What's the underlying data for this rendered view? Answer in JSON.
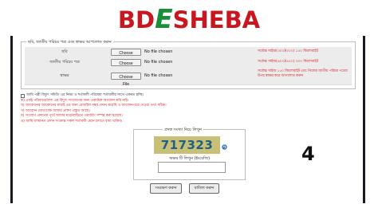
{
  "logo": {
    "part1": "BD",
    "part2": "E",
    "part3": "SHEBA"
  },
  "upload": {
    "legend": "ছবি, জাতীয় পরিচয় পত্র এবং স্বাক্ষর আপলোড করুন",
    "rows": [
      {
        "label": "ছবি",
        "button": "Choose File",
        "status": "No file chosen",
        "note": "সর্বোচ্চ সাইজ(৩০০X৩০০) ১৫০ কিলোবাইট"
      },
      {
        "label": "জাতীয় পরিচয় পত্র",
        "button": "Choose File",
        "status": "No file chosen",
        "note": "সর্বোচ্চ সাইজ(৬০০X৪৫০) ৩০০ কিলোবাইট"
      },
      {
        "label": "স্বাক্ষর",
        "button": "Choose File",
        "status": "No file chosen",
        "note": "সর্বোচ্চ সাইজ ১৫০ কিলোবাইট এবং নিজের জাতীয় পরিচয় পত্রের উপর স্বাক্ষর করে আপলোড করুন"
      }
    ]
  },
  "terms": {
    "agree": "আমি পল্লী বিদ্যুৎ সমিতি এর নিয়ম ও শর্তাবলী পরিষেবা শর্তাবলীর সাথে একমত হচ্ছি।",
    "items": [
      "ক) একই পরিবারে/বাসা এর বিদ্যুৎ সংযোগের জন্য একাধিক আবেদন করি নাই।",
      "খ) আবেদনের আবেদনের যাচাই এর জন্য মোবাইল নম্বর প্রদান করেছি ও আবেদনপত্রে দেওয়া তথ্য সঠিক।",
      "গ) আবেদন মোতাবেক আমার প্রাঙ্গণ প্রস্তুত আছে।",
      "ঘ) সংযোগ প্রদানের পূর্বে আমার ঘরে/বাড়িতে ওয়্যারিং সম্পন্ন করা হয়েছে।",
      "ঙ) আমি জামানত প্রদান সংক্রান্ত সকল শর্তাবলী মেনে চলতে বাধ্য থাকিব।"
    ]
  },
  "captcha": {
    "legend": "প্রদত্ত সংখ্যা নিচে লিখুন",
    "code": "717323",
    "input_label": "অক্ষর টি লিখুন (ইংরেজি)",
    "input_value": ""
  },
  "step_number": "4",
  "buttons": {
    "save": "সংরক্ষণ করুন",
    "cancel": "বাতিল করুন"
  }
}
